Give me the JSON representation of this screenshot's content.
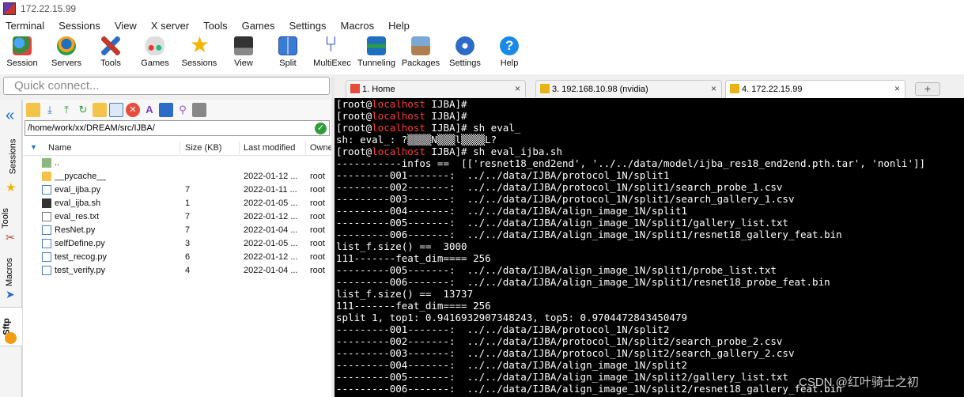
{
  "window": {
    "title": "172.22.15.99"
  },
  "menu": [
    "Terminal",
    "Sessions",
    "View",
    "X server",
    "Tools",
    "Games",
    "Settings",
    "Macros",
    "Help"
  ],
  "toolbar": [
    {
      "label": "Session",
      "icon": "session-icon"
    },
    {
      "label": "Servers",
      "icon": "servers-icon"
    },
    {
      "label": "Tools",
      "icon": "tools-icon"
    },
    {
      "label": "Games",
      "icon": "games-icon"
    },
    {
      "label": "Sessions",
      "icon": "star-icon"
    },
    {
      "label": "View",
      "icon": "view-icon"
    },
    {
      "label": "Split",
      "icon": "split-icon"
    },
    {
      "label": "MultiExec",
      "icon": "multiexec-icon"
    },
    {
      "label": "Tunneling",
      "icon": "tunneling-icon"
    },
    {
      "label": "Packages",
      "icon": "packages-icon"
    },
    {
      "label": "Settings",
      "icon": "settings-icon"
    },
    {
      "label": "Help",
      "icon": "help-icon"
    }
  ],
  "quick_connect": {
    "placeholder": "Quick connect..."
  },
  "side_tabs": [
    "Sessions",
    "Tools",
    "Macros",
    "Sftp"
  ],
  "sftp": {
    "path": "/home/work/xx/DREAM/src/IJBA/",
    "columns": [
      "Name",
      "Size (KB)",
      "Last modified",
      "Owner"
    ],
    "files": [
      {
        "name": "..",
        "size": "",
        "modified": "",
        "owner": "",
        "type": "up"
      },
      {
        "name": "__pycache__",
        "size": "",
        "modified": "2022-01-12 ...",
        "owner": "root",
        "type": "folder"
      },
      {
        "name": "eval_ijba.py",
        "size": "7",
        "modified": "2022-01-11 ...",
        "owner": "root",
        "type": "py"
      },
      {
        "name": "eval_ijba.sh",
        "size": "1",
        "modified": "2022-01-05 ...",
        "owner": "root",
        "type": "sh"
      },
      {
        "name": "eval_res.txt",
        "size": "7",
        "modified": "2022-01-12 ...",
        "owner": "root",
        "type": "txt"
      },
      {
        "name": "ResNet.py",
        "size": "7",
        "modified": "2022-01-04 ...",
        "owner": "root",
        "type": "py"
      },
      {
        "name": "selfDefine.py",
        "size": "3",
        "modified": "2022-01-05 ...",
        "owner": "root",
        "type": "py"
      },
      {
        "name": "test_recog.py",
        "size": "6",
        "modified": "2022-01-12 ...",
        "owner": "root",
        "type": "py"
      },
      {
        "name": "test_verify.py",
        "size": "4",
        "modified": "2022-01-04 ...",
        "owner": "root",
        "type": "py"
      }
    ]
  },
  "tabs": [
    {
      "label": "1. Home"
    },
    {
      "label": "3. 192.168.10.98 (nvidia)"
    },
    {
      "label": "4. 172.22.15.99"
    }
  ],
  "terminal": {
    "lines": [
      {
        "prompt": true,
        "user": "[root@",
        "host": "localhost",
        "rest": " IJBA]#"
      },
      {
        "prompt": true,
        "user": "[root@",
        "host": "localhost",
        "rest": " IJBA]#"
      },
      {
        "prompt": true,
        "user": "[root@",
        "host": "localhost",
        "rest": " IJBA]# sh eval_"
      },
      {
        "text": "sh: eval_: ?▒▒▒▒N▒▒▒l▒▒▒▒L?"
      },
      {
        "prompt": true,
        "user": "[root@",
        "host": "localhost",
        "rest": " IJBA]# sh eval_ijba.sh"
      },
      {
        "text": "-----------infos ==  [['resnet18_end2end', '../../data/model/ijba_res18_end2end.pth.tar', 'nonli']]"
      },
      {
        "text": "---------001-------:  ../../data/IJBA/protocol_1N/split1"
      },
      {
        "text": "---------002-------:  ../../data/IJBA/protocol_1N/split1/search_probe_1.csv"
      },
      {
        "text": "---------003-------:  ../../data/IJBA/protocol_1N/split1/search_gallery_1.csv"
      },
      {
        "text": "---------004-------:  ../../data/IJBA/align_image_1N/split1"
      },
      {
        "text": "---------005-------:  ../../data/IJBA/align_image_1N/split1/gallery_list.txt"
      },
      {
        "text": "---------006-------:  ../../data/IJBA/align_image_1N/split1/resnet18_gallery_feat.bin"
      },
      {
        "text": "list_f.size() ==  3000"
      },
      {
        "text": "111-------feat_dim==== 256"
      },
      {
        "text": "---------005-------:  ../../data/IJBA/align_image_1N/split1/probe_list.txt"
      },
      {
        "text": "---------006-------:  ../../data/IJBA/align_image_1N/split1/resnet18_probe_feat.bin"
      },
      {
        "text": "list_f.size() ==  13737"
      },
      {
        "text": "111-------feat_dim==== 256"
      },
      {
        "text": "split 1, top1: 0.9416932907348243, top5: 0.9704472843450479"
      },
      {
        "text": "---------001-------:  ../../data/IJBA/protocol_1N/split2"
      },
      {
        "text": "---------002-------:  ../../data/IJBA/protocol_1N/split2/search_probe_2.csv"
      },
      {
        "text": "---------003-------:  ../../data/IJBA/protocol_1N/split2/search_gallery_2.csv"
      },
      {
        "text": "---------004-------:  ../../data/IJBA/align_image_1N/split2"
      },
      {
        "text": "---------005-------:  ../../data/IJBA/align_image_1N/split2/gallery_list.txt"
      },
      {
        "text": "---------006-------:  ../../data/IJBA/align_image_1N/split2/resnet18_gallery_feat.bin"
      }
    ]
  },
  "watermark": "CSDN @红叶骑士之初",
  "colors": {
    "prompt_host": "#ff3b3b",
    "terminal_bg": "#000000",
    "terminal_fg": "#ffffff"
  }
}
